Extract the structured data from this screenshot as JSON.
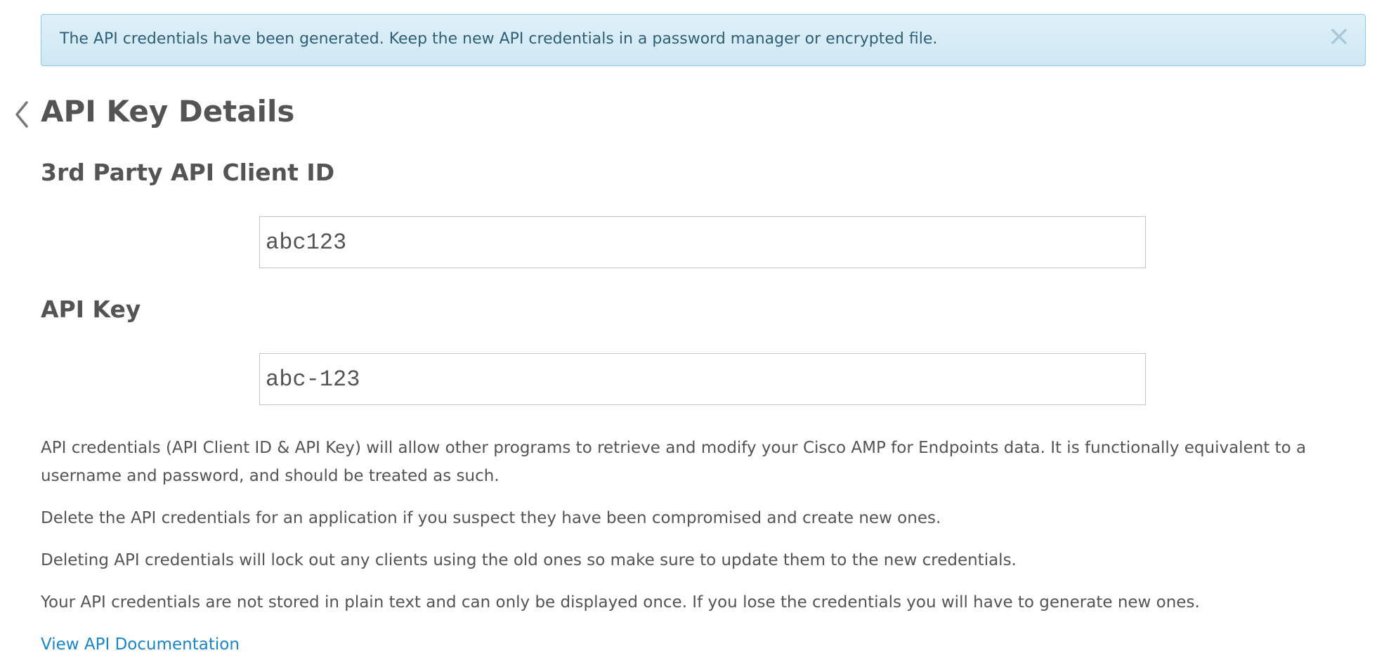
{
  "alert": {
    "message": "The API credentials have been generated. Keep the new API credentials in a password manager or encrypted file.",
    "close_icon": "close-icon",
    "background_color": "#d9edf7",
    "text_color": "#2f5f78"
  },
  "header": {
    "back_icon": "chevron-left-icon",
    "title": "API Key Details"
  },
  "client_id": {
    "heading": "3rd Party API Client ID",
    "value": "abc123"
  },
  "api_key": {
    "heading": "API Key",
    "value": "abc-123"
  },
  "info": {
    "paragraph_1": "API credentials (API Client ID & API Key) will allow other programs to retrieve and modify your Cisco AMP for Endpoints data. It is functionally equivalent to a username and password, and should be treated as such.",
    "paragraph_2": "Delete the API credentials for an application if you suspect they have been compromised and create new ones.",
    "paragraph_3": "Deleting API credentials will lock out any clients using the old ones so make sure to update them to the new credentials.",
    "paragraph_4": "Your API credentials are not stored in plain text and can only be displayed once. If you lose the credentials you will have to generate new ones."
  },
  "links": {
    "documentation": "View API Documentation",
    "link_color": "#1a85c6"
  }
}
